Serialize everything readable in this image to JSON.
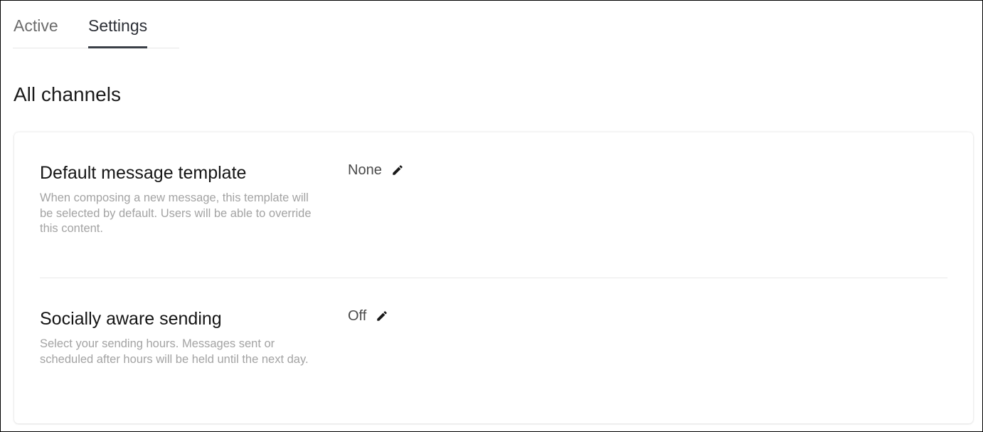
{
  "tabs": [
    {
      "label": "Active",
      "selected": false
    },
    {
      "label": "Settings",
      "selected": true
    }
  ],
  "page": {
    "title": "All channels"
  },
  "settings": [
    {
      "title": "Default message template",
      "description": "When composing a new message, this template will be selected by default. Users will be able to override this content.",
      "value": "None",
      "edit_icon": "pencil-icon"
    },
    {
      "title": "Socially aware sending",
      "description": "Select your sending hours. Messages sent or scheduled after hours will be held until the next day.",
      "value": "Off",
      "edit_icon": "pencil-icon"
    }
  ],
  "colors": {
    "tab_underline": "#3a3f47",
    "description_text": "#a3a3a3",
    "value_text": "#4a4a4a"
  }
}
